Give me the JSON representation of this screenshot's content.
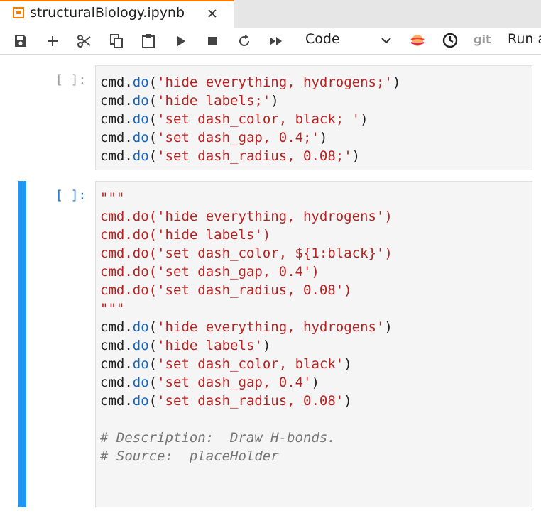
{
  "tab": {
    "title": "structuralBiology.ipynb"
  },
  "toolbar": {
    "cell_type": "Code",
    "git_label": "git",
    "run_label": "Run a",
    "icons": [
      "save-icon",
      "add-icon",
      "cut-icon",
      "copy-icon",
      "paste-icon",
      "run-icon",
      "stop-icon",
      "restart-icon",
      "fast-forward-icon",
      "chevron-down-icon",
      "jupyter-icon",
      "clock-icon"
    ]
  },
  "cells": [
    {
      "prompt": "[ ]:",
      "lines": [
        [
          {
            "t": "cmd.",
            "c": "kw"
          },
          {
            "t": "do",
            "c": "fn"
          },
          {
            "t": "(",
            "c": "pn"
          },
          {
            "t": "'hide everything, hydrogens;'",
            "c": "str"
          },
          {
            "t": ")",
            "c": "pn"
          }
        ],
        [
          {
            "t": "cmd.",
            "c": "kw"
          },
          {
            "t": "do",
            "c": "fn"
          },
          {
            "t": "(",
            "c": "pn"
          },
          {
            "t": "'hide labels;'",
            "c": "str"
          },
          {
            "t": ")",
            "c": "pn"
          }
        ],
        [
          {
            "t": "cmd.",
            "c": "kw"
          },
          {
            "t": "do",
            "c": "fn"
          },
          {
            "t": "(",
            "c": "pn"
          },
          {
            "t": "'set dash_color, black; '",
            "c": "str"
          },
          {
            "t": ")",
            "c": "pn"
          }
        ],
        [
          {
            "t": "cmd.",
            "c": "kw"
          },
          {
            "t": "do",
            "c": "fn"
          },
          {
            "t": "(",
            "c": "pn"
          },
          {
            "t": "'set dash_gap, 0.4;'",
            "c": "str"
          },
          {
            "t": ")",
            "c": "pn"
          }
        ],
        [
          {
            "t": "cmd.",
            "c": "kw"
          },
          {
            "t": "do",
            "c": "fn"
          },
          {
            "t": "(",
            "c": "pn"
          },
          {
            "t": "'set dash_radius, 0.08;'",
            "c": "str"
          },
          {
            "t": ")",
            "c": "pn"
          }
        ]
      ]
    },
    {
      "prompt": "[ ]:",
      "lines": [
        [
          {
            "t": "\"\"\"",
            "c": "str"
          }
        ],
        [
          {
            "t": "cmd.do('hide everything, hydrogens')",
            "c": "str"
          }
        ],
        [
          {
            "t": "cmd.do('hide labels')",
            "c": "str"
          }
        ],
        [
          {
            "t": "cmd.do('set dash_color, ${1:black}')",
            "c": "str"
          }
        ],
        [
          {
            "t": "cmd.do('set dash_gap, 0.4')",
            "c": "str"
          }
        ],
        [
          {
            "t": "cmd.do('set dash_radius, 0.08')",
            "c": "str"
          }
        ],
        [
          {
            "t": "\"\"\"",
            "c": "str"
          }
        ],
        [
          {
            "t": "cmd.",
            "c": "kw"
          },
          {
            "t": "do",
            "c": "fn"
          },
          {
            "t": "(",
            "c": "pn"
          },
          {
            "t": "'hide everything, hydrogens'",
            "c": "str"
          },
          {
            "t": ")",
            "c": "pn"
          }
        ],
        [
          {
            "t": "cmd.",
            "c": "kw"
          },
          {
            "t": "do",
            "c": "fn"
          },
          {
            "t": "(",
            "c": "pn"
          },
          {
            "t": "'hide labels'",
            "c": "str"
          },
          {
            "t": ")",
            "c": "pn"
          }
        ],
        [
          {
            "t": "cmd.",
            "c": "kw"
          },
          {
            "t": "do",
            "c": "fn"
          },
          {
            "t": "(",
            "c": "pn"
          },
          {
            "t": "'set dash_color, black'",
            "c": "str"
          },
          {
            "t": ")",
            "c": "pn"
          }
        ],
        [
          {
            "t": "cmd.",
            "c": "kw"
          },
          {
            "t": "do",
            "c": "fn"
          },
          {
            "t": "(",
            "c": "pn"
          },
          {
            "t": "'set dash_gap, 0.4'",
            "c": "str"
          },
          {
            "t": ")",
            "c": "pn"
          }
        ],
        [
          {
            "t": "cmd.",
            "c": "kw"
          },
          {
            "t": "do",
            "c": "fn"
          },
          {
            "t": "(",
            "c": "pn"
          },
          {
            "t": "'set dash_radius, 0.08'",
            "c": "str"
          },
          {
            "t": ")",
            "c": "pn"
          }
        ],
        [],
        [
          {
            "t": "# Description:  Draw H-bonds.",
            "c": "cm"
          }
        ],
        [
          {
            "t": "# Source:  placeHolder",
            "c": "cm"
          }
        ]
      ]
    }
  ],
  "colors": {
    "accent": "#f57c00",
    "selection": "#2196f3",
    "string": "#ba2121",
    "function": "#1565c0",
    "comment": "#757575"
  }
}
